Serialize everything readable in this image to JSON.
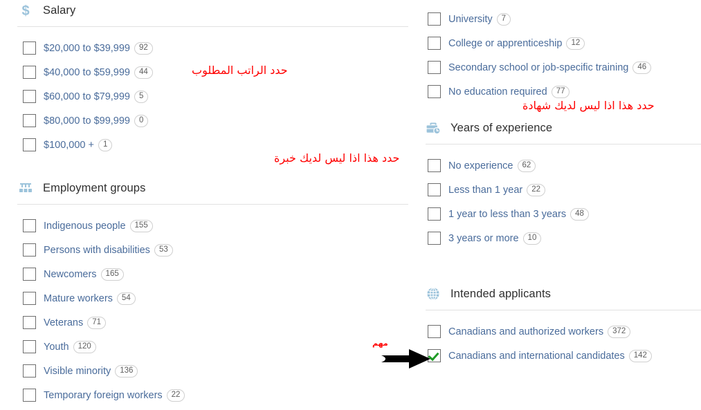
{
  "sections": {
    "salary": {
      "title": "Salary",
      "icon": "dollar-sign-icon",
      "options": [
        {
          "label": "$20,000 to $39,999",
          "count": "92",
          "checked": false
        },
        {
          "label": "$40,000 to $59,999",
          "count": "44",
          "checked": false
        },
        {
          "label": "$60,000 to $79,999",
          "count": "5",
          "checked": false
        },
        {
          "label": "$80,000 to $99,999",
          "count": "0",
          "checked": false
        },
        {
          "label": "$100,000 +",
          "count": "1",
          "checked": false
        }
      ]
    },
    "employment_groups": {
      "title": "Employment groups",
      "icon": "employment-groups-icon",
      "options": [
        {
          "label": "Indigenous people",
          "count": "155",
          "checked": false
        },
        {
          "label": "Persons with disabilities",
          "count": "53",
          "checked": false
        },
        {
          "label": "Newcomers",
          "count": "165",
          "checked": false
        },
        {
          "label": "Mature workers",
          "count": "54",
          "checked": false
        },
        {
          "label": "Veterans",
          "count": "71",
          "checked": false
        },
        {
          "label": "Youth",
          "count": "120",
          "checked": false
        },
        {
          "label": "Visible minority",
          "count": "136",
          "checked": false
        },
        {
          "label": "Temporary foreign workers",
          "count": "22",
          "checked": false
        }
      ]
    },
    "education": {
      "title": "",
      "icon": "",
      "options": [
        {
          "label": "University",
          "count": "7",
          "checked": false
        },
        {
          "label": "College or apprenticeship",
          "count": "12",
          "checked": false
        },
        {
          "label": "Secondary school or job-specific training",
          "count": "46",
          "checked": false
        },
        {
          "label": "No education required",
          "count": "77",
          "checked": false
        }
      ]
    },
    "years_of_experience": {
      "title": "Years of experience",
      "icon": "briefcase-clock-icon",
      "options": [
        {
          "label": "No experience",
          "count": "62",
          "checked": false
        },
        {
          "label": "Less than 1 year",
          "count": "22",
          "checked": false
        },
        {
          "label": "1 year to less than 3 years",
          "count": "48",
          "checked": false
        },
        {
          "label": "3 years or more",
          "count": "10",
          "checked": false
        }
      ]
    },
    "intended_applicants": {
      "title": "Intended applicants",
      "icon": "globe-icon",
      "options": [
        {
          "label": "Canadians and authorized workers",
          "count": "372",
          "checked": false
        },
        {
          "label": "Canadians and international candidates",
          "count": "142",
          "checked": true
        }
      ]
    }
  },
  "annotations": {
    "salary": "حدد الراتب المطلوب",
    "experience": "حدد هذا اذا ليس لديك خبرة",
    "education": "حدد هذا اذا ليس لديك شهادة",
    "important": "مهم"
  },
  "colors": {
    "annotation_red": "#ff0000",
    "link_blue": "#4a6c9b",
    "icon_blue": "#9cc3db",
    "check_green": "#1f9b26",
    "heading_gray": "#2f2f2f",
    "badge_border": "#cfcfcf",
    "rule_gray": "#e2e2e2"
  }
}
